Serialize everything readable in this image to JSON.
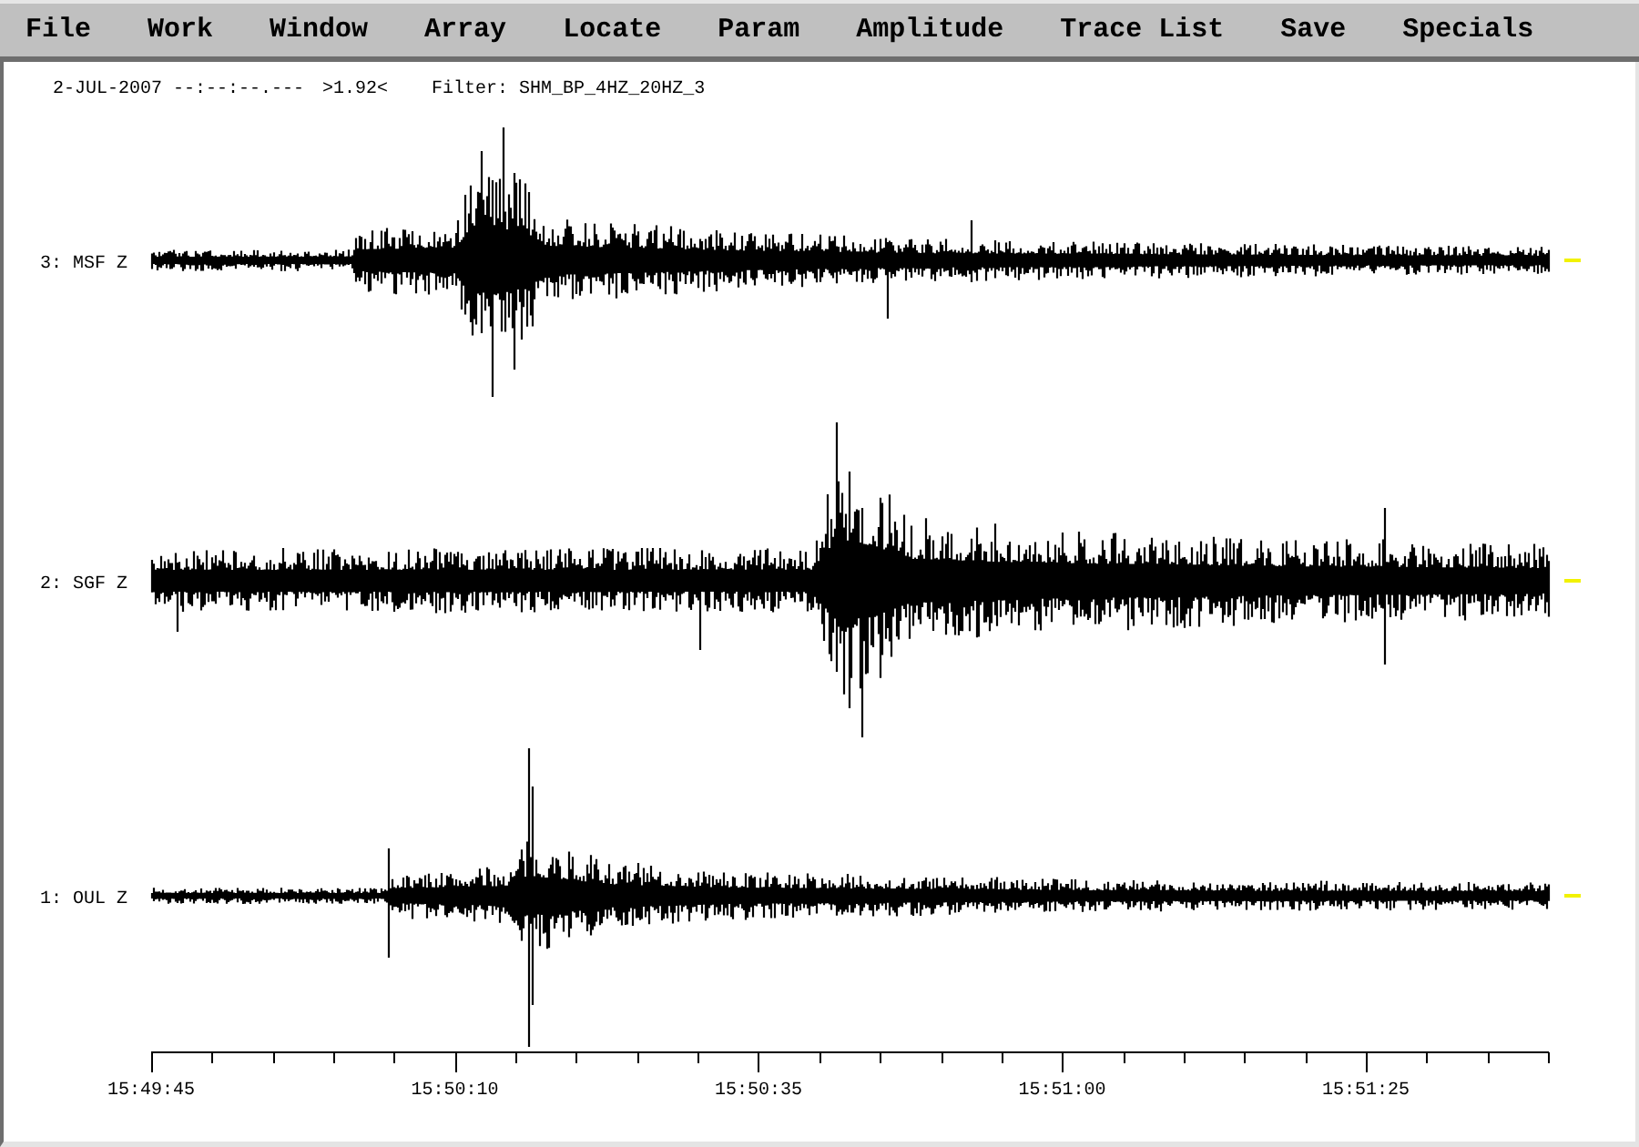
{
  "menu": [
    "File",
    "Work",
    "Window",
    "Array",
    "Locate",
    "Param",
    "Amplitude",
    "Trace List",
    "Save",
    "Specials"
  ],
  "header": {
    "datetime": "2-JUL-2007 --:--:--.---",
    "scale": ">1.92<",
    "filter": "Filter: SHM_BP_4HZ_20HZ_3"
  },
  "traces": [
    "3: MSF Z",
    "2: SGF Z",
    "1: OUL Z"
  ],
  "time_axis": {
    "labels": [
      "15:49:45",
      "15:50:10",
      "15:50:35",
      "15:51:00",
      "15:51:25"
    ]
  }
}
